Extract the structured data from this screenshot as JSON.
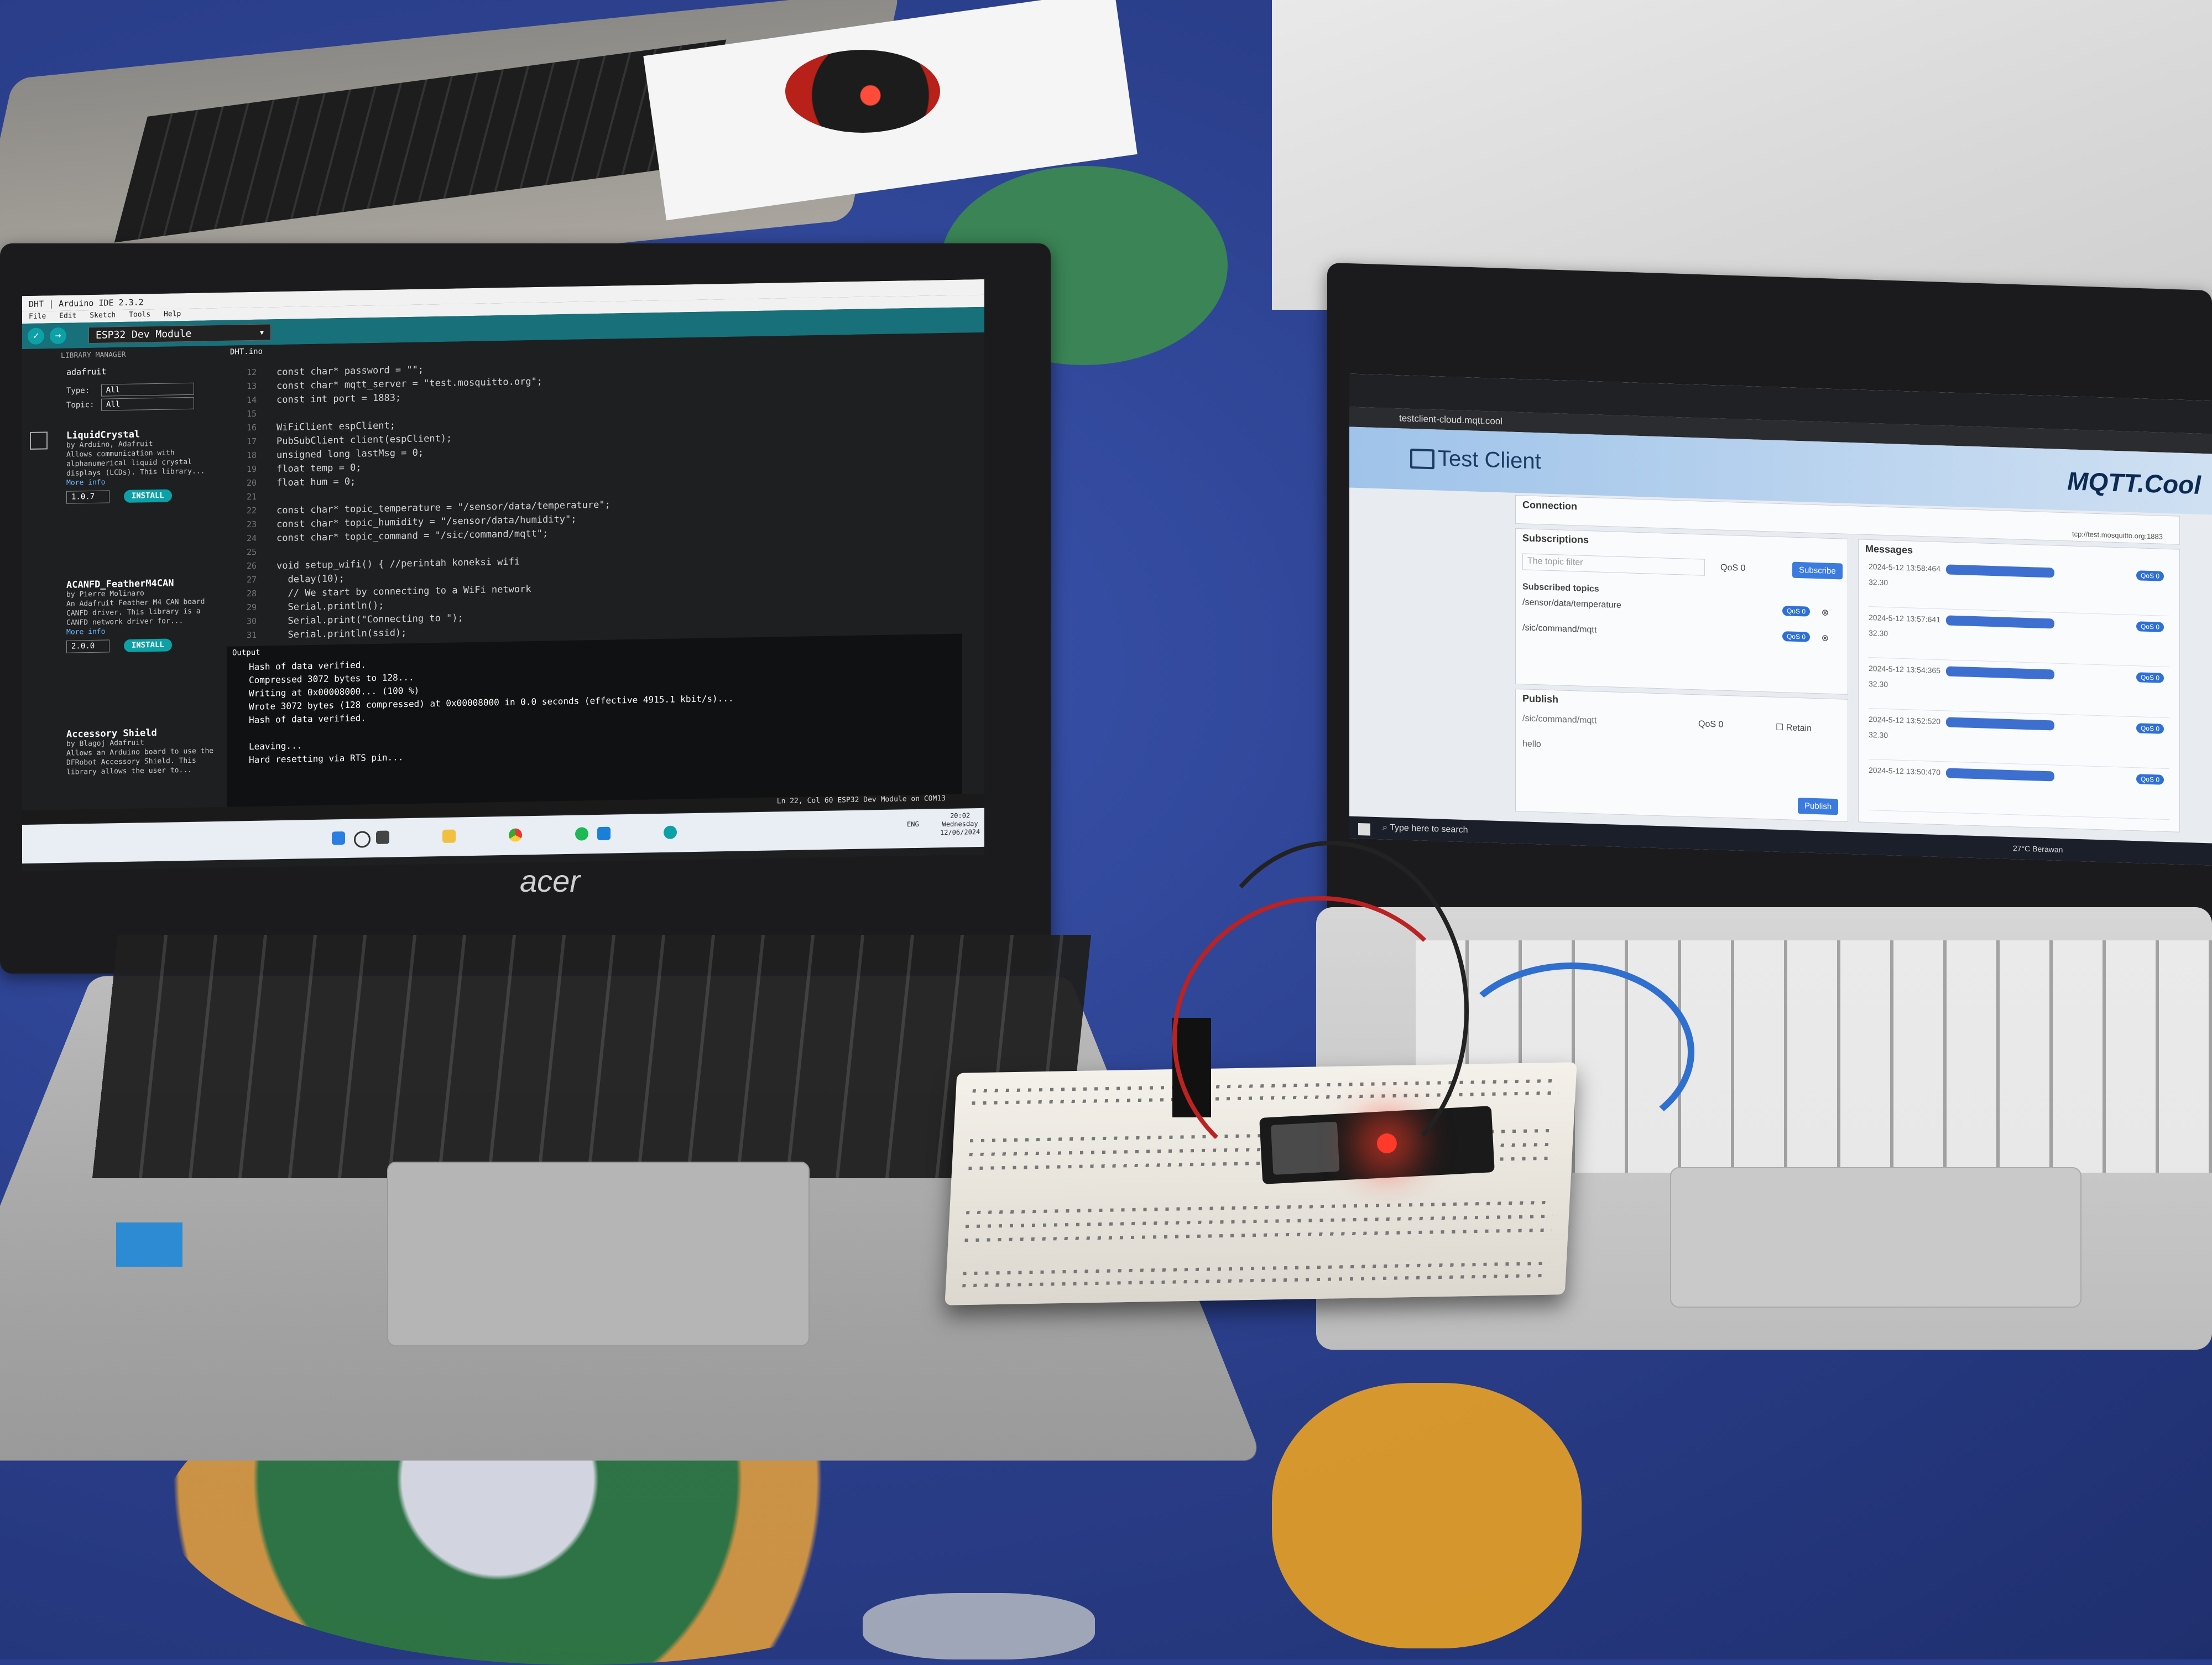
{
  "ide": {
    "window_title": "DHT | Arduino IDE 2.3.2",
    "menu": [
      "File",
      "Edit",
      "Sketch",
      "Tools",
      "Help"
    ],
    "board": "ESP32 Dev Module",
    "library_manager": {
      "header": "LIBRARY MANAGER",
      "search": "adafruit",
      "type_label": "Type:",
      "type_value": "All",
      "topic_label": "Topic:",
      "topic_value": "All",
      "libraries": [
        {
          "name": "LiquidCrystal",
          "by": "by Arduino, Adafruit",
          "desc": "Allows communication with alphanumerical liquid crystal displays (LCDs). This library...",
          "more": "More info",
          "version": "1.0.7",
          "button": "INSTALL"
        },
        {
          "name": "ACANFD_FeatherM4CAN",
          "by": "by Pierre Molinaro",
          "desc": "An Adafruit Feather M4 CAN board CANFD driver. This library is a CANFD network driver for...",
          "more": "More info",
          "version": "2.0.0",
          "button": "INSTALL"
        },
        {
          "name": "Accessory Shield",
          "by": "by Blagoj Adafruit",
          "desc": "Allows an Arduino board to use the DFRobot Accessory Shield. This library allows the user to...",
          "more": "",
          "version": "",
          "button": ""
        }
      ]
    },
    "file_tab": "DHT.ino",
    "code_lines": [
      {
        "n": "12",
        "text": "const char* password = \"\";"
      },
      {
        "n": "13",
        "text": "const char* mqtt_server = \"test.mosquitto.org\";"
      },
      {
        "n": "14",
        "text": "const int port = 1883;"
      },
      {
        "n": "15",
        "text": ""
      },
      {
        "n": "16",
        "text": "WiFiClient espClient;"
      },
      {
        "n": "17",
        "text": "PubSubClient client(espClient);"
      },
      {
        "n": "18",
        "text": "unsigned long lastMsg = 0;"
      },
      {
        "n": "19",
        "text": "float temp = 0;"
      },
      {
        "n": "20",
        "text": "float hum = 0;"
      },
      {
        "n": "21",
        "text": ""
      },
      {
        "n": "22",
        "text": "const char* topic_temperature = \"/sensor/data/temperature\";"
      },
      {
        "n": "23",
        "text": "const char* topic_humidity = \"/sensor/data/humidity\";"
      },
      {
        "n": "24",
        "text": "const char* topic_command = \"/sic/command/mqtt\";"
      },
      {
        "n": "25",
        "text": ""
      },
      {
        "n": "26",
        "text": "void setup_wifi() { //perintah koneksi wifi"
      },
      {
        "n": "27",
        "text": "  delay(10);"
      },
      {
        "n": "28",
        "text": "  // We start by connecting to a WiFi network"
      },
      {
        "n": "29",
        "text": "  Serial.println();"
      },
      {
        "n": "30",
        "text": "  Serial.print(\"Connecting to \");"
      },
      {
        "n": "31",
        "text": "  Serial.println(ssid);"
      }
    ],
    "output_header": "Output",
    "output_lines": [
      "Hash of data verified.",
      "Compressed 3072 bytes to 128...",
      "Writing at 0x00008000... (100 %)",
      "Wrote 3072 bytes (128 compressed) at 0x00008000 in 0.0 seconds (effective 4915.1 kbit/s)...",
      "Hash of data verified.",
      "",
      "Leaving...",
      "Hard resetting via RTS pin..."
    ],
    "status": "Ln 22, Col 60   ESP32 Dev Module on COM13",
    "clock_time": "20:02",
    "clock_day": "Wednesday",
    "clock_date": "12/06/2024",
    "taskbar_lang": "ENG"
  },
  "laptop_brand": "acer",
  "mqtt": {
    "url": "testclient-cloud.mqtt.cool",
    "title": "Test Client",
    "brand": "MQTT.Cool",
    "connection_label": "Connection",
    "broker": "tcp://test.mosquitto.org:1883",
    "subscriptions_label": "Subscriptions",
    "topic_filter_placeholder": "The topic filter",
    "qos_value": "QoS 0",
    "subscribe_button": "Subscribe",
    "subscribed_topics_label": "Subscribed topics",
    "subscribed_topics": [
      {
        "topic": "/sensor/data/temperature",
        "qos": "QoS 0"
      },
      {
        "topic": "/sic/command/mqtt",
        "qos": "QoS 0"
      }
    ],
    "publish_label": "Publish",
    "publish_topic": "/sic/command/mqtt",
    "publish_qos": "QoS 0",
    "retain_label": "Retain",
    "publish_message": "hello",
    "publish_button": "Publish",
    "messages_label": "Messages",
    "messages": [
      {
        "time": "2024-5-12 13:58:464",
        "value": "32.30",
        "qos": "QoS 0"
      },
      {
        "time": "2024-5-12 13:57:641",
        "value": "32.30",
        "qos": "QoS 0"
      },
      {
        "time": "2024-5-12 13:54:365",
        "value": "32.30",
        "qos": "QoS 0"
      },
      {
        "time": "2024-5-12 13:52:520",
        "value": "32.30",
        "qos": "QoS 0"
      },
      {
        "time": "2024-5-12 13:50:470",
        "value": "",
        "qos": "QoS 0"
      }
    ],
    "taskbar_search": "Type here to search",
    "weather": "27°C Berawan"
  },
  "colors": {
    "arduino_teal": "#17707a",
    "install_button": "#0ca1a6",
    "mqtt_blue": "#3b7be0",
    "esp_led": "#ff3a2a"
  }
}
